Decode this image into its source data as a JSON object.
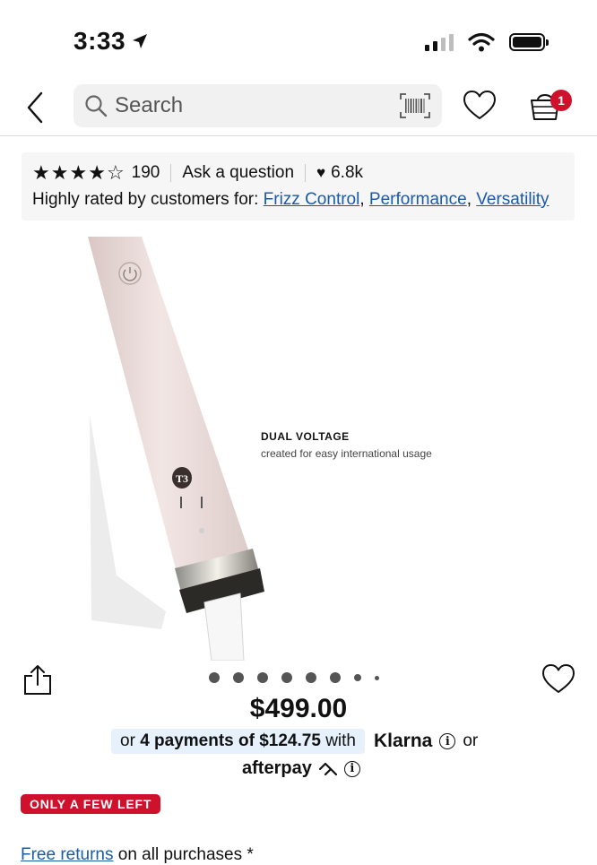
{
  "status_bar": {
    "time": "3:33"
  },
  "nav": {
    "search_placeholder": "Search",
    "basket_count": "1"
  },
  "reviews": {
    "rating_count": "190",
    "ask_question": "Ask a question",
    "loves": "6.8k",
    "highly_rated_prefix": "Highly rated by customers for:",
    "highlights": [
      "Frizz Control",
      "Performance",
      "Versatility"
    ]
  },
  "product_image": {
    "brand_mark": "T3",
    "callout_title": "DUAL VOLTAGE",
    "callout_subtitle": "created for easy international usage"
  },
  "carousel": {
    "dot_count": 8,
    "active_index": 0
  },
  "pricing": {
    "price": "$499.00",
    "klarna_prefix": "or",
    "klarna_payments": "4 payments of $124.75",
    "klarna_with": "with",
    "klarna_brand": "Klarna",
    "or_text": "or",
    "afterpay_brand": "afterpay"
  },
  "stock_badge": "ONLY A FEW LEFT",
  "returns": {
    "link": "Free returns",
    "rest": "on all purchases *"
  },
  "colors": {
    "accent_red": "#cf112c",
    "link_blue": "#1a5ba8",
    "klarna_bg": "#e6f1fb"
  }
}
